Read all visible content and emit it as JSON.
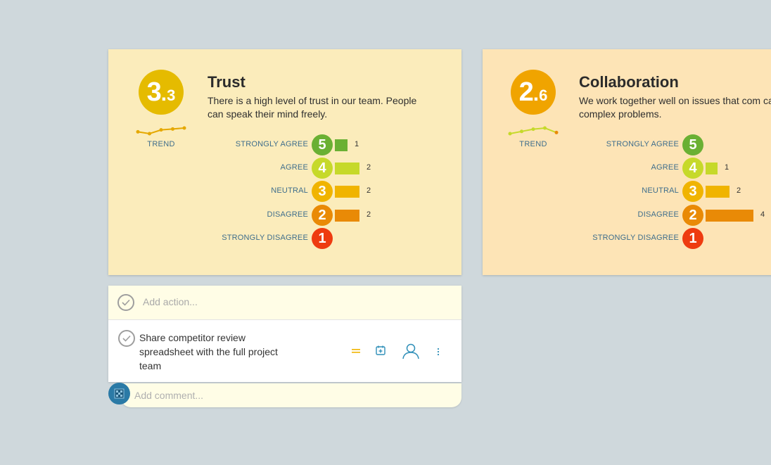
{
  "colors": {
    "strongly_agree": "#6ab033",
    "agree": "#c6d92a",
    "neutral": "#f0b400",
    "disagree": "#e98a06",
    "strongly_disagree": "#ee3b10",
    "trust_score": "#e5bb00",
    "collab_score": "#f0a400"
  },
  "cards": [
    {
      "title": "Trust",
      "description": "There is a high level of trust in our team. People can speak their mind freely.",
      "score_whole": "3",
      "score_sep": ".",
      "score_fraction": "3",
      "trend_label": "TREND",
      "trend_points": [
        3.1,
        3.0,
        3.2,
        3.25,
        3.3
      ],
      "responses": [
        {
          "label": "STRONGLY AGREE",
          "value": "5",
          "count": 1,
          "count_text": "1"
        },
        {
          "label": "AGREE",
          "value": "4",
          "count": 2,
          "count_text": "2"
        },
        {
          "label": "NEUTRAL",
          "value": "3",
          "count": 2,
          "count_text": "2"
        },
        {
          "label": "DISAGREE",
          "value": "2",
          "count": 2,
          "count_text": "2"
        },
        {
          "label": "STRONGLY DISAGREE",
          "value": "1",
          "count": 0,
          "count_text": ""
        }
      ]
    },
    {
      "title": "Collaboration",
      "description": "We work together well on issues that com can solve complex problems.",
      "score_whole": "2",
      "score_sep": ".",
      "score_fraction": "6",
      "trend_label": "TREND",
      "trend_points": [
        2.5,
        2.6,
        2.7,
        2.75,
        2.55
      ],
      "responses": [
        {
          "label": "STRONGLY AGREE",
          "value": "5",
          "count": 0,
          "count_text": ""
        },
        {
          "label": "AGREE",
          "value": "4",
          "count": 1,
          "count_text": "1"
        },
        {
          "label": "NEUTRAL",
          "value": "3",
          "count": 2,
          "count_text": "2"
        },
        {
          "label": "DISAGREE",
          "value": "2",
          "count": 4,
          "count_text": "4"
        },
        {
          "label": "STRONGLY DISAGREE",
          "value": "1",
          "count": 0,
          "count_text": ""
        }
      ]
    }
  ],
  "actions": {
    "add_placeholder": "Add action...",
    "items": [
      {
        "text": "Share competitor review spreadsheet with the full project team"
      }
    ]
  },
  "comment": {
    "placeholder": "Add comment..."
  }
}
